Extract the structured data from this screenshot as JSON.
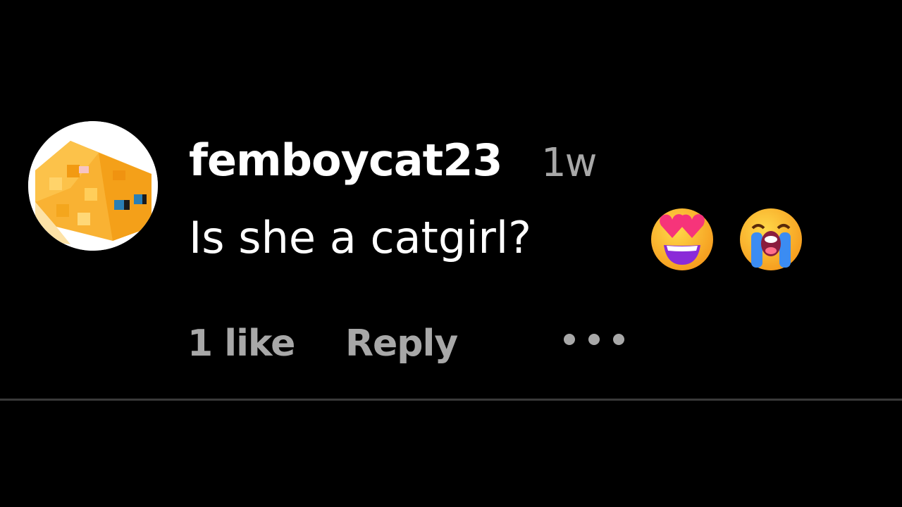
{
  "comment": {
    "username": "femboycat23",
    "timestamp": "1w",
    "text": "Is she a catgirl?",
    "emojis": [
      "smiling-face-with-heart-eyes",
      "loudly-crying-face"
    ]
  },
  "actions": {
    "likes_label": "1 like",
    "reply_label": "Reply",
    "more_icon": "more-options-icon"
  },
  "colors": {
    "background": "#000000",
    "primary_text": "#ffffff",
    "secondary_text": "#a8a8a8",
    "divider": "#3a3a3a",
    "avatar_cat": "#f7a51b"
  }
}
